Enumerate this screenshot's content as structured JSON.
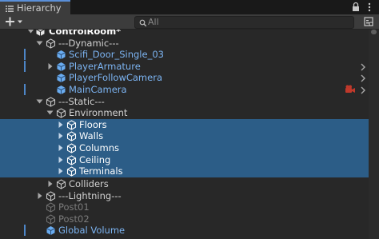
{
  "tab": {
    "title": "Hierarchy",
    "icon": "list-icon"
  },
  "search": {
    "placeholder": "All",
    "value": ""
  },
  "scene": {
    "title": "ControlRoom*"
  },
  "items": [
    {
      "label": "---Dynamic---",
      "style": "normal",
      "expanded": true,
      "icon": "gameobject-cube-icon"
    },
    {
      "label": "Scifi_Door_Single_03",
      "style": "prefab",
      "icon": "prefab-cube-icon"
    },
    {
      "label": "PlayerArmature",
      "style": "prefab",
      "icon": "prefab-cube-icon",
      "chevron": true
    },
    {
      "label": "PlayerFollowCamera",
      "style": "prefab",
      "icon": "prefab-cube-icon",
      "chevron": true
    },
    {
      "label": "MainCamera",
      "style": "prefab",
      "icon": "prefab-cube-icon",
      "chevron": true,
      "badge": "camera-icon"
    },
    {
      "label": "---Static---",
      "style": "normal",
      "expanded": true,
      "icon": "gameobject-cube-icon"
    },
    {
      "label": "Environment",
      "style": "normal",
      "expanded": true,
      "icon": "gameobject-cube-icon"
    },
    {
      "label": "Floors",
      "style": "white",
      "selected": true,
      "icon": "gameobject-cube-icon"
    },
    {
      "label": "Walls",
      "style": "white",
      "selected": true,
      "icon": "gameobject-cube-icon"
    },
    {
      "label": "Columns",
      "style": "white",
      "selected": true,
      "icon": "gameobject-cube-icon"
    },
    {
      "label": "Ceiling",
      "style": "white",
      "selected": true,
      "icon": "gameobject-cube-icon"
    },
    {
      "label": "Terminals",
      "style": "white",
      "selected": true,
      "icon": "gameobject-cube-icon"
    },
    {
      "label": "Colliders",
      "style": "normal",
      "icon": "gameobject-cube-icon"
    },
    {
      "label": "---Lightning---",
      "style": "normal",
      "icon": "gameobject-cube-icon"
    },
    {
      "label": "Post01",
      "style": "disabled",
      "icon": "gameobject-cube-icon"
    },
    {
      "label": "Post02",
      "style": "disabled",
      "icon": "gameobject-cube-icon"
    },
    {
      "label": "Global Volume",
      "style": "prefab",
      "icon": "prefab-cube-icon"
    }
  ],
  "colors": {
    "background": "#282828",
    "selection": "#2c5d87",
    "prefab_text": "#7cb4f2",
    "disabled_text": "#7b7b7b",
    "tab_accent": "#5a8fd8"
  }
}
